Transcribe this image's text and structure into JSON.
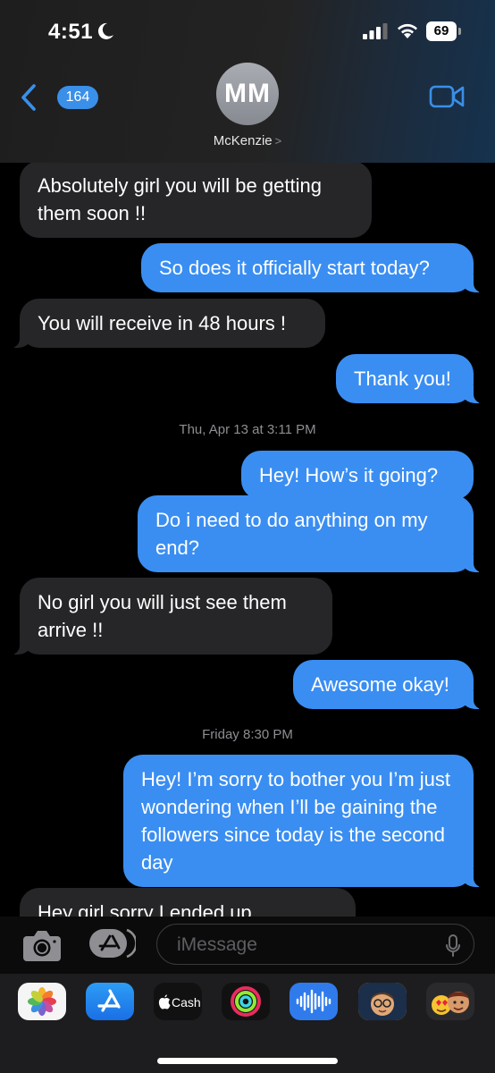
{
  "status_bar": {
    "time": "4:51",
    "battery": "69"
  },
  "nav": {
    "back_count": "164",
    "avatar_initials": "MM",
    "contact_name": "McKenzie",
    "contact_chevron": ">"
  },
  "messages": [
    {
      "kind": "received",
      "text": "Absolutely girl you will be getting them soon !!"
    },
    {
      "kind": "sent",
      "text": "So does it officially start today?"
    },
    {
      "kind": "received",
      "text": "You will receive in 48 hours !"
    },
    {
      "kind": "sent",
      "text": "Thank you!"
    },
    {
      "kind": "timestamp",
      "day": "Thu, Apr 13",
      "at": "at",
      "time": "3:11 PM"
    },
    {
      "kind": "sent",
      "text": "Hey! How’s it going?"
    },
    {
      "kind": "sent",
      "text": "Do i need to do anything on my end?"
    },
    {
      "kind": "received",
      "text": "No girl you will just see them arrive !!"
    },
    {
      "kind": "sent",
      "text": "Awesome okay!"
    },
    {
      "kind": "timestamp",
      "day": "Friday",
      "time": "8:30 PM"
    },
    {
      "kind": "sent",
      "text": "Hey! I’m sorry to bother you I’m just wondering when I’ll be gaining the followers since today is the second day"
    },
    {
      "kind": "received",
      "text": "Hey girl sorry I ended up"
    }
  ],
  "composer": {
    "placeholder": "iMessage"
  },
  "app_drawer": {
    "apps": [
      {
        "icon": "photos-icon"
      },
      {
        "icon": "app-store-icon"
      },
      {
        "icon": "apple-cash-icon",
        "label": "Cash"
      },
      {
        "icon": "activity-icon"
      },
      {
        "icon": "audio-message-icon"
      },
      {
        "icon": "memoji-icon"
      },
      {
        "icon": "animoji-icon"
      }
    ]
  },
  "colors": {
    "sent_bubble": "#3a8ef2",
    "received_bubble": "#262628",
    "accent": "#3a8fe8"
  }
}
